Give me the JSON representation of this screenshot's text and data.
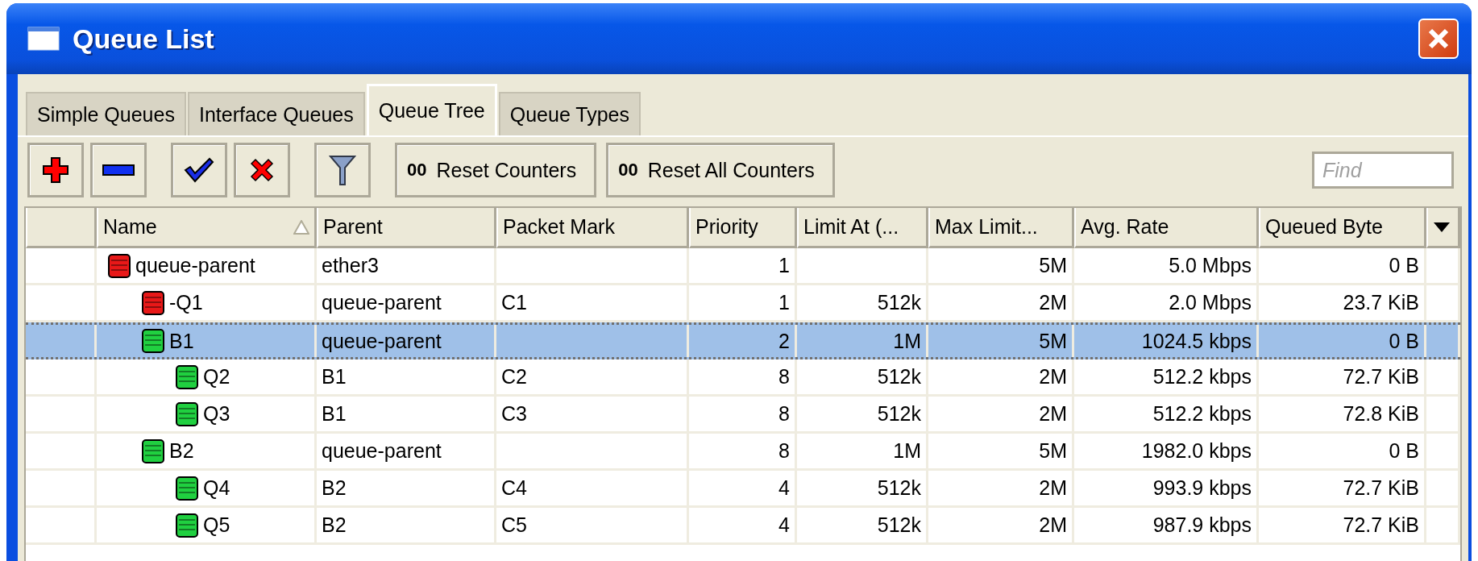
{
  "window": {
    "title": "Queue List"
  },
  "tabs": [
    {
      "label": "Simple Queues",
      "selected": false
    },
    {
      "label": "Interface Queues",
      "selected": false
    },
    {
      "label": "Queue Tree",
      "selected": true
    },
    {
      "label": "Queue Types",
      "selected": false
    }
  ],
  "toolbar": [
    {
      "kind": "add"
    },
    {
      "kind": "remove"
    },
    {
      "kind": "enable"
    },
    {
      "kind": "disable"
    },
    {
      "kind": "filter"
    },
    {
      "kind": "text",
      "mark": "00",
      "label": "Reset Counters"
    },
    {
      "kind": "text",
      "mark": "00",
      "label": "Reset All Counters"
    }
  ],
  "search": {
    "placeholder": "Find"
  },
  "table": {
    "columns": [
      {
        "label": "Name",
        "sorted": true
      },
      {
        "label": "Parent",
        "sorted": false
      },
      {
        "label": "Packet Mark",
        "sorted": false
      },
      {
        "label": "Priority",
        "sorted": false
      },
      {
        "label": "Limit At (...",
        "sorted": false
      },
      {
        "label": "Max Limit...",
        "sorted": false
      },
      {
        "label": "Avg. Rate",
        "sorted": false
      },
      {
        "label": "Queued Byte",
        "sorted": false
      }
    ],
    "rows": [
      {
        "color": "#e81818",
        "selected": false,
        "cells": [
          "queue-parent",
          "ether3",
          "",
          "1",
          "",
          "5M",
          "5.0 Mbps",
          "0 B"
        ],
        "children": [
          {
            "color": "#e81818",
            "selected": false,
            "cells": [
              "-Q1",
              "queue-parent",
              "C1",
              "1",
              "512k",
              "2M",
              "2.0 Mbps",
              "23.7 KiB"
            ]
          },
          {
            "color": "#20d040",
            "selected": true,
            "cells": [
              "B1",
              "queue-parent",
              "",
              "2",
              "1M",
              "5M",
              "1024.5 kbps",
              "0 B"
            ],
            "children": [
              {
                "color": "#20d040",
                "selected": false,
                "cells": [
                  "Q2",
                  "B1",
                  "C2",
                  "8",
                  "512k",
                  "2M",
                  "512.2 kbps",
                  "72.7 KiB"
                ]
              },
              {
                "color": "#20d040",
                "selected": false,
                "cells": [
                  "Q3",
                  "B1",
                  "C3",
                  "8",
                  "512k",
                  "2M",
                  "512.2 kbps",
                  "72.8 KiB"
                ]
              }
            ]
          },
          {
            "color": "#20d040",
            "selected": false,
            "cells": [
              "B2",
              "queue-parent",
              "",
              "8",
              "1M",
              "5M",
              "1982.0 kbps",
              "0 B"
            ],
            "children": [
              {
                "color": "#20d040",
                "selected": false,
                "cells": [
                  "Q4",
                  "B2",
                  "C4",
                  "4",
                  "512k",
                  "2M",
                  "993.9 kbps",
                  "72.7 KiB"
                ]
              },
              {
                "color": "#20d040",
                "selected": false,
                "cells": [
                  "Q5",
                  "B2",
                  "C5",
                  "4",
                  "512k",
                  "2M",
                  "987.9 kbps",
                  "72.7 KiB"
                ]
              }
            ]
          }
        ]
      }
    ]
  }
}
